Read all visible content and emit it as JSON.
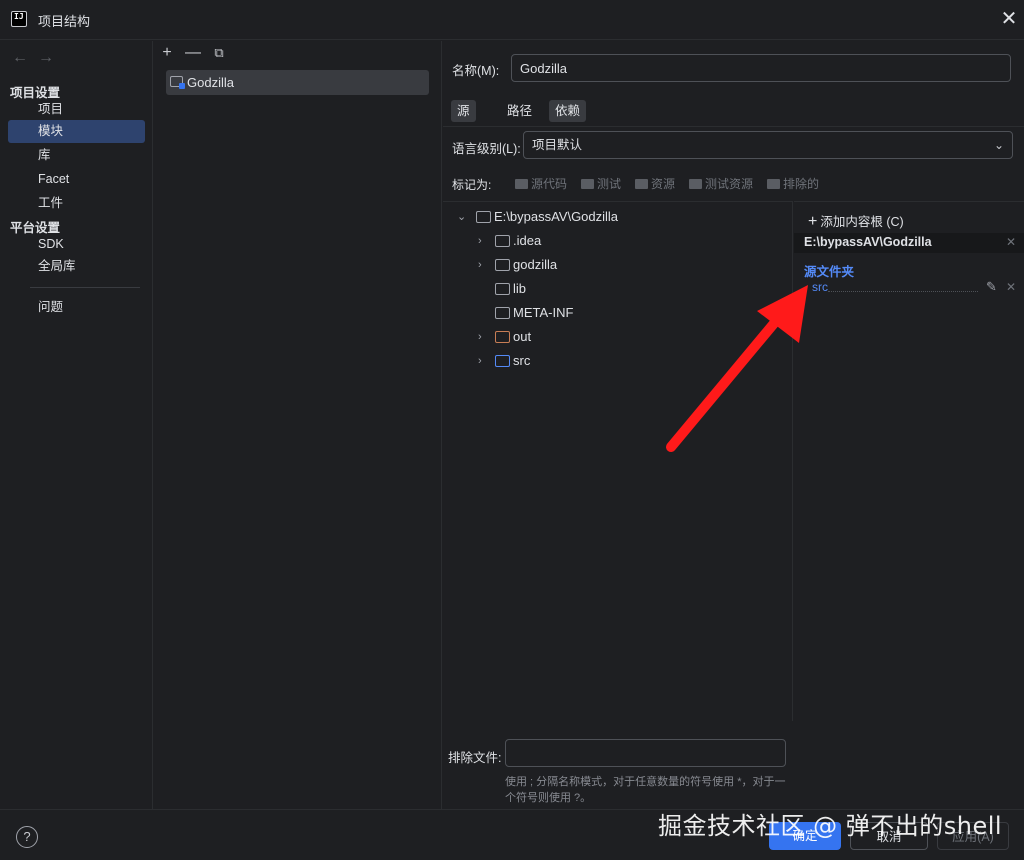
{
  "window": {
    "title": "项目结构",
    "close_glyph": "✕"
  },
  "nav": {
    "back": "←",
    "forward": "→",
    "section_project": "项目设置",
    "section_platform": "平台设置",
    "items": [
      {
        "label": "项目"
      },
      {
        "label": "模块"
      },
      {
        "label": "库"
      },
      {
        "label": "Facet"
      },
      {
        "label": "工件"
      },
      {
        "label": "SDK"
      },
      {
        "label": "全局库"
      },
      {
        "label": "问题"
      }
    ],
    "selected": "模块"
  },
  "module_toolbar": {
    "add": "+",
    "remove": "—",
    "copy": "⧉"
  },
  "modules": [
    {
      "name": "Godzilla"
    }
  ],
  "form": {
    "name_label": "名称(M):",
    "name_value": "Godzilla",
    "tabs": [
      {
        "label": "源"
      },
      {
        "label": "路径"
      },
      {
        "label": "依赖"
      }
    ],
    "language_label": "语言级别(L):",
    "language_value": "项目默认",
    "mark_as_label": "标记为:",
    "mark_as": [
      {
        "label": "源代码"
      },
      {
        "label": "测试"
      },
      {
        "label": "资源"
      },
      {
        "label": "测试资源"
      },
      {
        "label": "排除的"
      }
    ]
  },
  "tree": {
    "root": "E:\\bypassAV\\Godzilla",
    "children": [
      {
        "name": ".idea",
        "expandable": true,
        "color": "gray"
      },
      {
        "name": "godzilla",
        "expandable": true,
        "color": "gray"
      },
      {
        "name": "lib",
        "expandable": false,
        "color": "gray"
      },
      {
        "name": "META-INF",
        "expandable": false,
        "color": "gray"
      },
      {
        "name": "out",
        "expandable": true,
        "color": "orange"
      },
      {
        "name": "src",
        "expandable": true,
        "color": "blue"
      }
    ]
  },
  "content_root": {
    "add_label": "添加内容根 (C)",
    "path": "E:\\bypassAV\\Godzilla",
    "source_folders_title": "源文件夹",
    "source_folders": [
      "src"
    ]
  },
  "exclude": {
    "label": "排除文件:",
    "value": "",
    "hint": "使用 ; 分隔名称模式，对于任意数量的符号使用 *，对于一个符号则使用 ?。"
  },
  "buttons": {
    "ok": "确定",
    "cancel": "取消",
    "apply": "应用(A)",
    "help": "?"
  },
  "watermark": "掘金技术社区 @ 弹不出的shell",
  "colors": {
    "accent": "#3574f0",
    "selection": "#2e436e",
    "source_blue": "#548af7",
    "excluded_orange": "#c77d55",
    "annotation_arrow": "#ff1a1a"
  }
}
